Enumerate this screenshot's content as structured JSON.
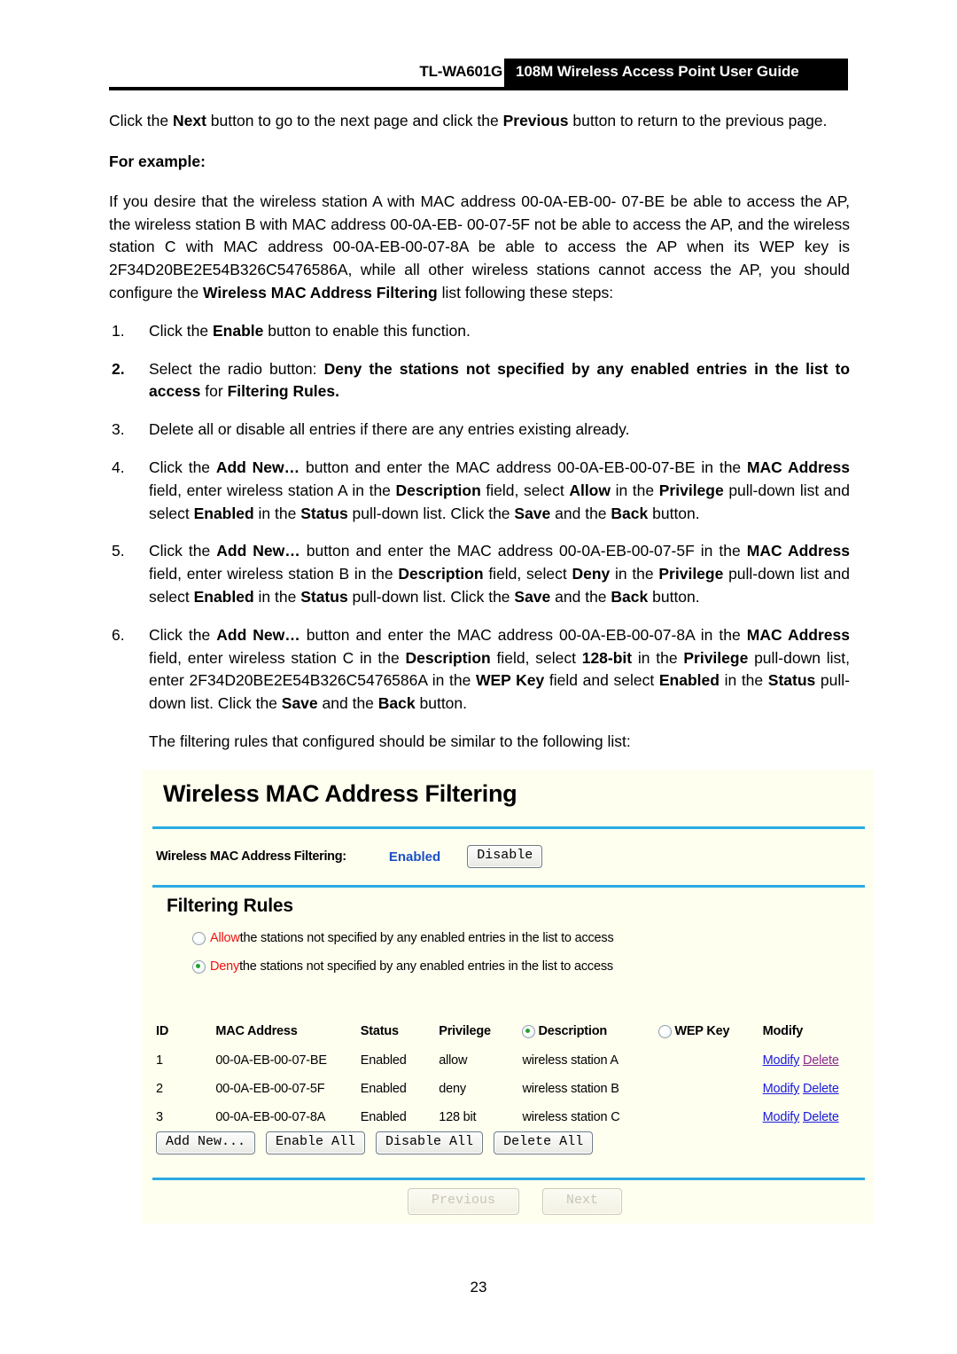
{
  "header": {
    "model": "TL-WA601G",
    "guide_title": "108M Wireless Access Point User Guide"
  },
  "body": {
    "intro_1": "Click the ",
    "intro_next": "Next",
    "intro_2": " button to go to the next page and click the ",
    "intro_previous": "Previous",
    "intro_3": " button to return to the previous page.",
    "for_example_label": "For example:",
    "example_text_1": "If you desire that the wireless station A with MAC address 00-0A-EB-00- 07-BE be able to access the AP, the wireless station B with MAC address 00-0A-EB- 00-07-5F not be able to access the AP, and the wireless station C with MAC address 00-0A-EB-00-07-8A be able to access the AP when its WEP key is 2F34D20BE2E54B326C5476586A, while all other wireless stations cannot access the AP, you should configure the ",
    "example_bold_1": "Wireless MAC Address Filtering",
    "example_text_2": " list following these steps:",
    "trailer": "The filtering rules that configured should be similar to the following list:"
  },
  "steps": [
    {
      "num": "1.",
      "parts": [
        {
          "t": "Click the ",
          "b": false
        },
        {
          "t": "Enable",
          "b": true
        },
        {
          "t": " button to enable this function.",
          "b": false
        }
      ]
    },
    {
      "num": "2.",
      "parts": [
        {
          "t": "Select the radio button: ",
          "b": false
        },
        {
          "t": "Deny the stations not specified by any enabled entries in the list to access",
          "b": true
        },
        {
          "t": " for ",
          "b": false
        },
        {
          "t": "Filtering Rules.",
          "b": true
        }
      ]
    },
    {
      "num": "3.",
      "parts": [
        {
          "t": "Delete all or disable all entries if there are any entries existing already.",
          "b": false
        }
      ]
    },
    {
      "num": "4.",
      "parts": [
        {
          "t": "Click the ",
          "b": false
        },
        {
          "t": "Add New…",
          "b": true
        },
        {
          "t": " button and enter the MAC address 00-0A-EB-00-07-BE in the ",
          "b": false
        },
        {
          "t": "MAC Address",
          "b": true
        },
        {
          "t": " field, enter wireless station A in the ",
          "b": false
        },
        {
          "t": "Description",
          "b": true
        },
        {
          "t": " field, select ",
          "b": false
        },
        {
          "t": "Allow",
          "b": true
        },
        {
          "t": " in the ",
          "b": false
        },
        {
          "t": "Privilege",
          "b": true
        },
        {
          "t": " pull-down list and select ",
          "b": false
        },
        {
          "t": "Enabled",
          "b": true
        },
        {
          "t": " in the ",
          "b": false
        },
        {
          "t": "Status",
          "b": true
        },
        {
          "t": " pull-down list. Click the ",
          "b": false
        },
        {
          "t": "Save",
          "b": true
        },
        {
          "t": " and the ",
          "b": false
        },
        {
          "t": "Back",
          "b": true
        },
        {
          "t": " button.",
          "b": false
        }
      ]
    },
    {
      "num": "5.",
      "parts": [
        {
          "t": "Click the ",
          "b": false
        },
        {
          "t": "Add New…",
          "b": true
        },
        {
          "t": " button and enter the MAC address 00-0A-EB-00-07-5F in the ",
          "b": false
        },
        {
          "t": "MAC Address",
          "b": true
        },
        {
          "t": " field, enter wireless station B in the ",
          "b": false
        },
        {
          "t": "Description",
          "b": true
        },
        {
          "t": " field, select ",
          "b": false
        },
        {
          "t": "Deny",
          "b": true
        },
        {
          "t": " in the ",
          "b": false
        },
        {
          "t": "Privilege",
          "b": true
        },
        {
          "t": " pull-down list and select ",
          "b": false
        },
        {
          "t": "Enabled",
          "b": true
        },
        {
          "t": " in the ",
          "b": false
        },
        {
          "t": "Status",
          "b": true
        },
        {
          "t": " pull-down list. Click the ",
          "b": false
        },
        {
          "t": "Save",
          "b": true
        },
        {
          "t": " and the ",
          "b": false
        },
        {
          "t": "Back",
          "b": true
        },
        {
          "t": " button.",
          "b": false
        }
      ]
    },
    {
      "num": "6.",
      "parts": [
        {
          "t": "Click the ",
          "b": false
        },
        {
          "t": "Add New…",
          "b": true
        },
        {
          "t": " button and enter the MAC address 00-0A-EB-00-07-8A in the ",
          "b": false
        },
        {
          "t": "MAC Address",
          "b": true
        },
        {
          "t": " field, enter wireless station C in the ",
          "b": false
        },
        {
          "t": "Description",
          "b": true
        },
        {
          "t": " field, select ",
          "b": false
        },
        {
          "t": "128-bit",
          "b": true
        },
        {
          "t": " in the ",
          "b": false
        },
        {
          "t": "Privilege",
          "b": true
        },
        {
          "t": " pull-down list, enter 2F34D20BE2E54B326C5476586A in the ",
          "b": false
        },
        {
          "t": "WEP Key",
          "b": true
        },
        {
          "t": " field and select ",
          "b": false
        },
        {
          "t": "Enabled",
          "b": true
        },
        {
          "t": " in the ",
          "b": false
        },
        {
          "t": "Status",
          "b": true
        },
        {
          "t": " pull-down list. Click the ",
          "b": false
        },
        {
          "t": "Save",
          "b": true
        },
        {
          "t": " and the ",
          "b": false
        },
        {
          "t": "Back",
          "b": true
        },
        {
          "t": " button.",
          "b": false
        }
      ]
    }
  ],
  "ui_panel": {
    "title": "Wireless MAC Address Filtering",
    "filter_label": "Wireless MAC Address Filtering:",
    "filter_state": "Enabled",
    "filter_button": "Disable",
    "rules_heading": "Filtering Rules",
    "rules": [
      {
        "keyword": "Allow",
        "text": " the stations not specified by any enabled entries in the list to access",
        "selected": false
      },
      {
        "keyword": "Deny",
        "text": " the stations not specified by any enabled entries in the list to access",
        "selected": true
      }
    ],
    "table": {
      "headers": {
        "id": "ID",
        "mac": "MAC Address",
        "status": "Status",
        "privilege": "Privilege",
        "description": "Description",
        "wep_key": "WEP Key",
        "modify": "Modify"
      },
      "description_selected": true,
      "wep_key_selected": false,
      "rows": [
        {
          "id": "1",
          "mac": "00-0A-EB-00-07-BE",
          "status": "Enabled",
          "privilege": "allow",
          "description": "wireless station A",
          "modify": "Modify",
          "delete": "Delete",
          "delete_visited": true
        },
        {
          "id": "2",
          "mac": "00-0A-EB-00-07-5F",
          "status": "Enabled",
          "privilege": "deny",
          "description": "wireless station B",
          "modify": "Modify",
          "delete": "Delete",
          "delete_visited": false
        },
        {
          "id": "3",
          "mac": "00-0A-EB-00-07-8A",
          "status": "Enabled",
          "privilege": "128 bit",
          "description": "wireless station C",
          "modify": "Modify",
          "delete": "Delete",
          "delete_visited": false
        }
      ]
    },
    "actions": {
      "add_new": "Add New...",
      "enable_all": "Enable All",
      "disable_all": "Disable All",
      "delete_all": "Delete All"
    },
    "nav": {
      "previous": "Previous",
      "next": "Next"
    },
    "colors": {
      "panel_bg": "#fffff0",
      "divider": "#29abe2",
      "state_blue": "#1a4fc4",
      "keyword_red": "#ee1111",
      "link_blue": "#1b1bdd",
      "link_visited": "#8a2a8a"
    }
  },
  "footer": {
    "page_number": "23"
  }
}
